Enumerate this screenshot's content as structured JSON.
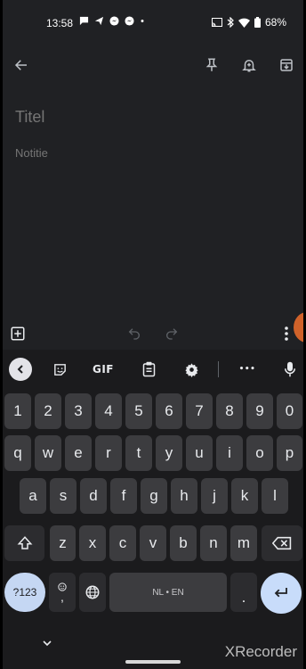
{
  "status_bar": {
    "time": "13:58",
    "battery": "68%"
  },
  "note": {
    "title_placeholder": "Titel",
    "body_placeholder": "Notitie"
  },
  "keyboard": {
    "toolbar": {
      "gif_label": "GIF",
      "more_label": "•••"
    },
    "rows": {
      "numbers": [
        "1",
        "2",
        "3",
        "4",
        "5",
        "6",
        "7",
        "8",
        "9",
        "0"
      ],
      "row1": [
        "q",
        "w",
        "e",
        "r",
        "t",
        "y",
        "u",
        "i",
        "o",
        "p"
      ],
      "row2": [
        "a",
        "s",
        "d",
        "f",
        "g",
        "h",
        "j",
        "k",
        "l"
      ],
      "row3": [
        "z",
        "x",
        "c",
        "v",
        "b",
        "n",
        "m"
      ]
    },
    "symbols_label": "?123",
    "comma_label": ",",
    "space_label": "NL • EN",
    "period_label": "."
  },
  "nav": {
    "watermark": "XRecorder"
  },
  "colors": {
    "background": "#202124",
    "keyboard": "#1b1b1d",
    "key": "#3c3c3f",
    "accent_key": "#c8dcfa",
    "bubble": "#d0622a"
  }
}
